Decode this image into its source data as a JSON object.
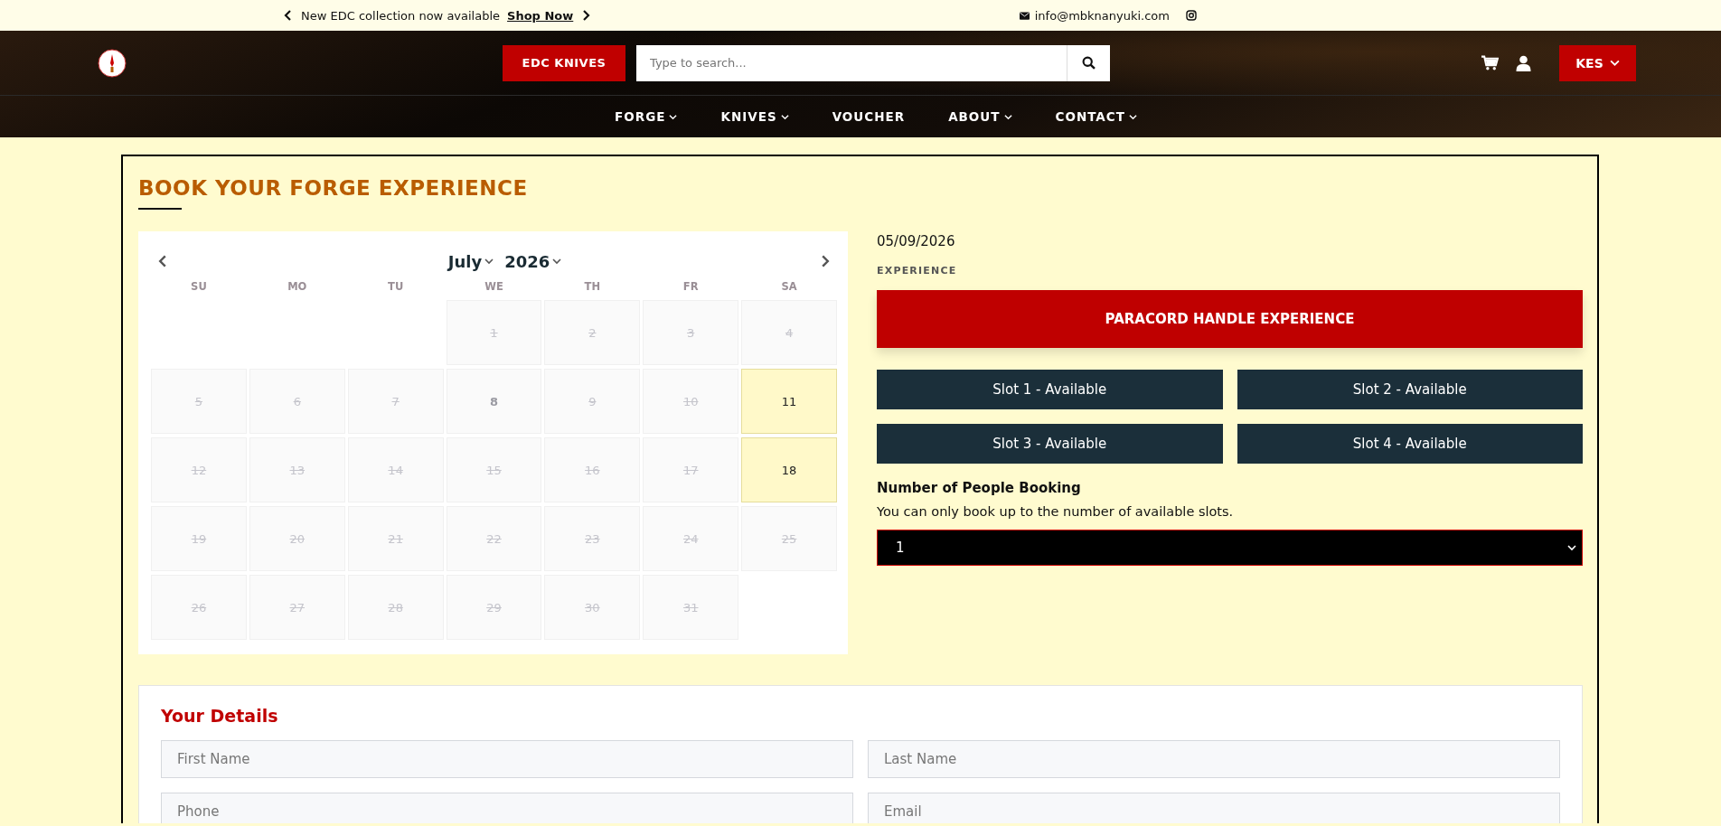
{
  "announcement": {
    "text": "New EDC collection now available",
    "link": "Shop Now"
  },
  "contact": {
    "email": "info@mbknanyuki.com"
  },
  "header": {
    "category_button": "EDC KNIVES",
    "search": {
      "placeholder": "Type to search..."
    },
    "currency": "KES"
  },
  "nav": [
    {
      "label": "FORGE",
      "dropdown": true
    },
    {
      "label": "KNIVES",
      "dropdown": true
    },
    {
      "label": "VOUCHER",
      "dropdown": false
    },
    {
      "label": "ABOUT",
      "dropdown": true
    },
    {
      "label": "CONTACT",
      "dropdown": true
    }
  ],
  "page_title": "BOOK YOUR FORGE EXPERIENCE",
  "calendar": {
    "month": "July",
    "year": "2026",
    "weekdays": [
      "SU",
      "MO",
      "TU",
      "WE",
      "TH",
      "FR",
      "SA"
    ],
    "weeks": [
      [
        {
          "day": "1",
          "disabled": true,
          "available": false
        },
        {
          "day": "2",
          "disabled": true,
          "available": false
        },
        {
          "day": "3",
          "disabled": true,
          "available": false
        },
        {
          "day": "4",
          "disabled": true,
          "available": false
        }
      ],
      [
        {
          "day": "5",
          "disabled": true,
          "available": false
        },
        {
          "day": "6",
          "disabled": true,
          "available": false
        },
        {
          "day": "7",
          "disabled": true,
          "available": false
        },
        {
          "day": "8",
          "disabled": false,
          "available": false
        },
        {
          "day": "9",
          "disabled": true,
          "available": false
        },
        {
          "day": "10",
          "disabled": true,
          "available": false
        },
        {
          "day": "11",
          "disabled": false,
          "available": true
        }
      ],
      [
        {
          "day": "12",
          "disabled": true,
          "available": false
        },
        {
          "day": "13",
          "disabled": true,
          "available": false
        },
        {
          "day": "14",
          "disabled": true,
          "available": false
        },
        {
          "day": "15",
          "disabled": true,
          "available": false
        },
        {
          "day": "16",
          "disabled": true,
          "available": false
        },
        {
          "day": "17",
          "disabled": true,
          "available": false
        },
        {
          "day": "18",
          "disabled": false,
          "available": true
        }
      ],
      [
        {
          "day": "19",
          "disabled": true,
          "available": false
        },
        {
          "day": "20",
          "disabled": true,
          "available": false
        },
        {
          "day": "21",
          "disabled": true,
          "available": false
        },
        {
          "day": "22",
          "disabled": true,
          "available": false
        },
        {
          "day": "23",
          "disabled": true,
          "available": false
        },
        {
          "day": "24",
          "disabled": true,
          "available": false
        },
        {
          "day": "25",
          "disabled": true,
          "available": false
        }
      ],
      [
        {
          "day": "26",
          "disabled": true,
          "available": false
        },
        {
          "day": "27",
          "disabled": true,
          "available": false
        },
        {
          "day": "28",
          "disabled": true,
          "available": false
        },
        {
          "day": "29",
          "disabled": true,
          "available": false
        },
        {
          "day": "30",
          "disabled": true,
          "available": false
        },
        {
          "day": "31",
          "disabled": true,
          "available": false
        }
      ]
    ]
  },
  "booking": {
    "date": "05/09/2026",
    "experience_label": "EXPERIENCE",
    "experience": "PARACORD HANDLE EXPERIENCE",
    "slots": [
      "Slot 1 - Available",
      "Slot 2 - Available",
      "Slot 3 - Available",
      "Slot 4 - Available"
    ],
    "people_heading": "Number of People Booking",
    "people_note": "You can only book up to the number of available slots.",
    "people_value": "1"
  },
  "details": {
    "title": "Your Details",
    "fields": [
      {
        "placeholder": "First Name"
      },
      {
        "placeholder": "Last Name"
      },
      {
        "placeholder": "Phone"
      },
      {
        "placeholder": "Email"
      }
    ]
  }
}
